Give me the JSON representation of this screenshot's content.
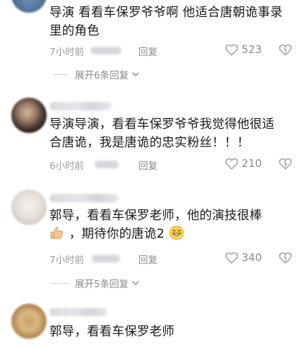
{
  "comments": [
    {
      "text_line1": "导演 看看车保罗爷爷啊 他适合唐朝诡事录",
      "text_line2": "里的角色",
      "time": "7小时前",
      "reply": "回复",
      "likes": "523",
      "expand": "展开6条回复"
    },
    {
      "text_line1": "导演导演，看看车保罗爷爷我觉得他很适",
      "text_line2": "合唐诡，我是唐诡的忠实粉丝！！！",
      "time": "6小时前",
      "reply": "回复",
      "likes": "210"
    },
    {
      "text_line1": "郭导，看看车保罗老师，他的演技很棒",
      "text_line2": "，期待你的唐诡2",
      "time": "7小时前",
      "reply": "回复",
      "likes": "340",
      "expand": "展开5条回复"
    },
    {
      "text_line1": "郭导，看看车保罗老师"
    }
  ],
  "icons": {
    "like": "heart-outline-icon",
    "dislike": "heart-broken-icon",
    "expand_chevron": "chevron-down-icon",
    "thumbs_up_emoji": "thumbs-up-emoji-icon",
    "grin_emoji": "grin-emoji-icon"
  },
  "colors": {
    "text": "#1a1a1a",
    "meta": "#9a9a9a"
  }
}
